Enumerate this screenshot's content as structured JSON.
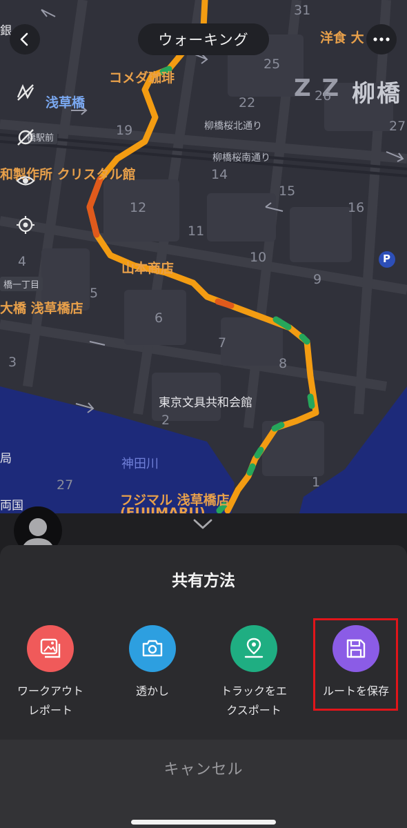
{
  "header": {
    "mode_label": "ウォーキング",
    "back_icon": "chevron-left-icon",
    "more_icon": "more-dots-icon"
  },
  "map": {
    "layer_tools": [
      "map-layer-off-icon",
      "layer-hidden-icon",
      "eye-icon",
      "locate-icon"
    ],
    "labels": {
      "gin": "銀",
      "komeda": "コメダ珈琲",
      "asakusabashi_station": "浅草橋",
      "yoshoku": "洋食 大",
      "yanagibashi": "柳橋",
      "zz": "Z Z",
      "station_front": "橋駅前",
      "yanagibashi_sakura_n": "柳橋桜北通り",
      "yanagibashi_sakura_s": "柳橋桜南通り",
      "crystal": "和製作所 クリスタル館",
      "yamamoto": "山本商店",
      "ohashi": "大橋 浅草橋店",
      "bashi_1chome": "橋一丁目",
      "tokyo_bungu": "東京文具共和会館",
      "kandagawa": "神田川",
      "fujimaru": "フジマル 浅草橋店",
      "fujimaru_en": "(FUJIMARU)",
      "kyoku": "局",
      "ryogoku": "両国",
      "parking": "P",
      "n31": "31",
      "n25": "25",
      "n22": "22",
      "n26": "26",
      "n27a": "27",
      "n19": "19",
      "n14": "14",
      "n15": "15",
      "n16": "16",
      "n12": "12",
      "n11": "11",
      "n10": "10",
      "n9": "9",
      "n4": "4",
      "n5": "5",
      "n6": "6",
      "n7": "7",
      "n8": "8",
      "n3": "3",
      "n2": "2",
      "n1": "1",
      "n27b": "27"
    }
  },
  "share_sheet": {
    "title": "共有方法",
    "options": [
      {
        "label_line1": "ワークアウト",
        "label_line2": "レポート",
        "icon": "image-icon",
        "color": "#f05a5a"
      },
      {
        "label_line1": "透かし",
        "label_line2": "",
        "icon": "camera-icon",
        "color": "#2d9fe0"
      },
      {
        "label_line1": "トラックをエ",
        "label_line2": "クスポート",
        "icon": "route-pin-icon",
        "color": "#1fae82"
      },
      {
        "label_line1": "ルートを保存",
        "label_line2": "",
        "icon": "save-icon",
        "color": "#8b5ce6"
      }
    ],
    "cancel_label": "キャンセル"
  },
  "colors": {
    "track_orange": "#f39c12",
    "track_red": "#e05a1c",
    "track_green": "#26a65b",
    "highlight": "#e1151a"
  }
}
